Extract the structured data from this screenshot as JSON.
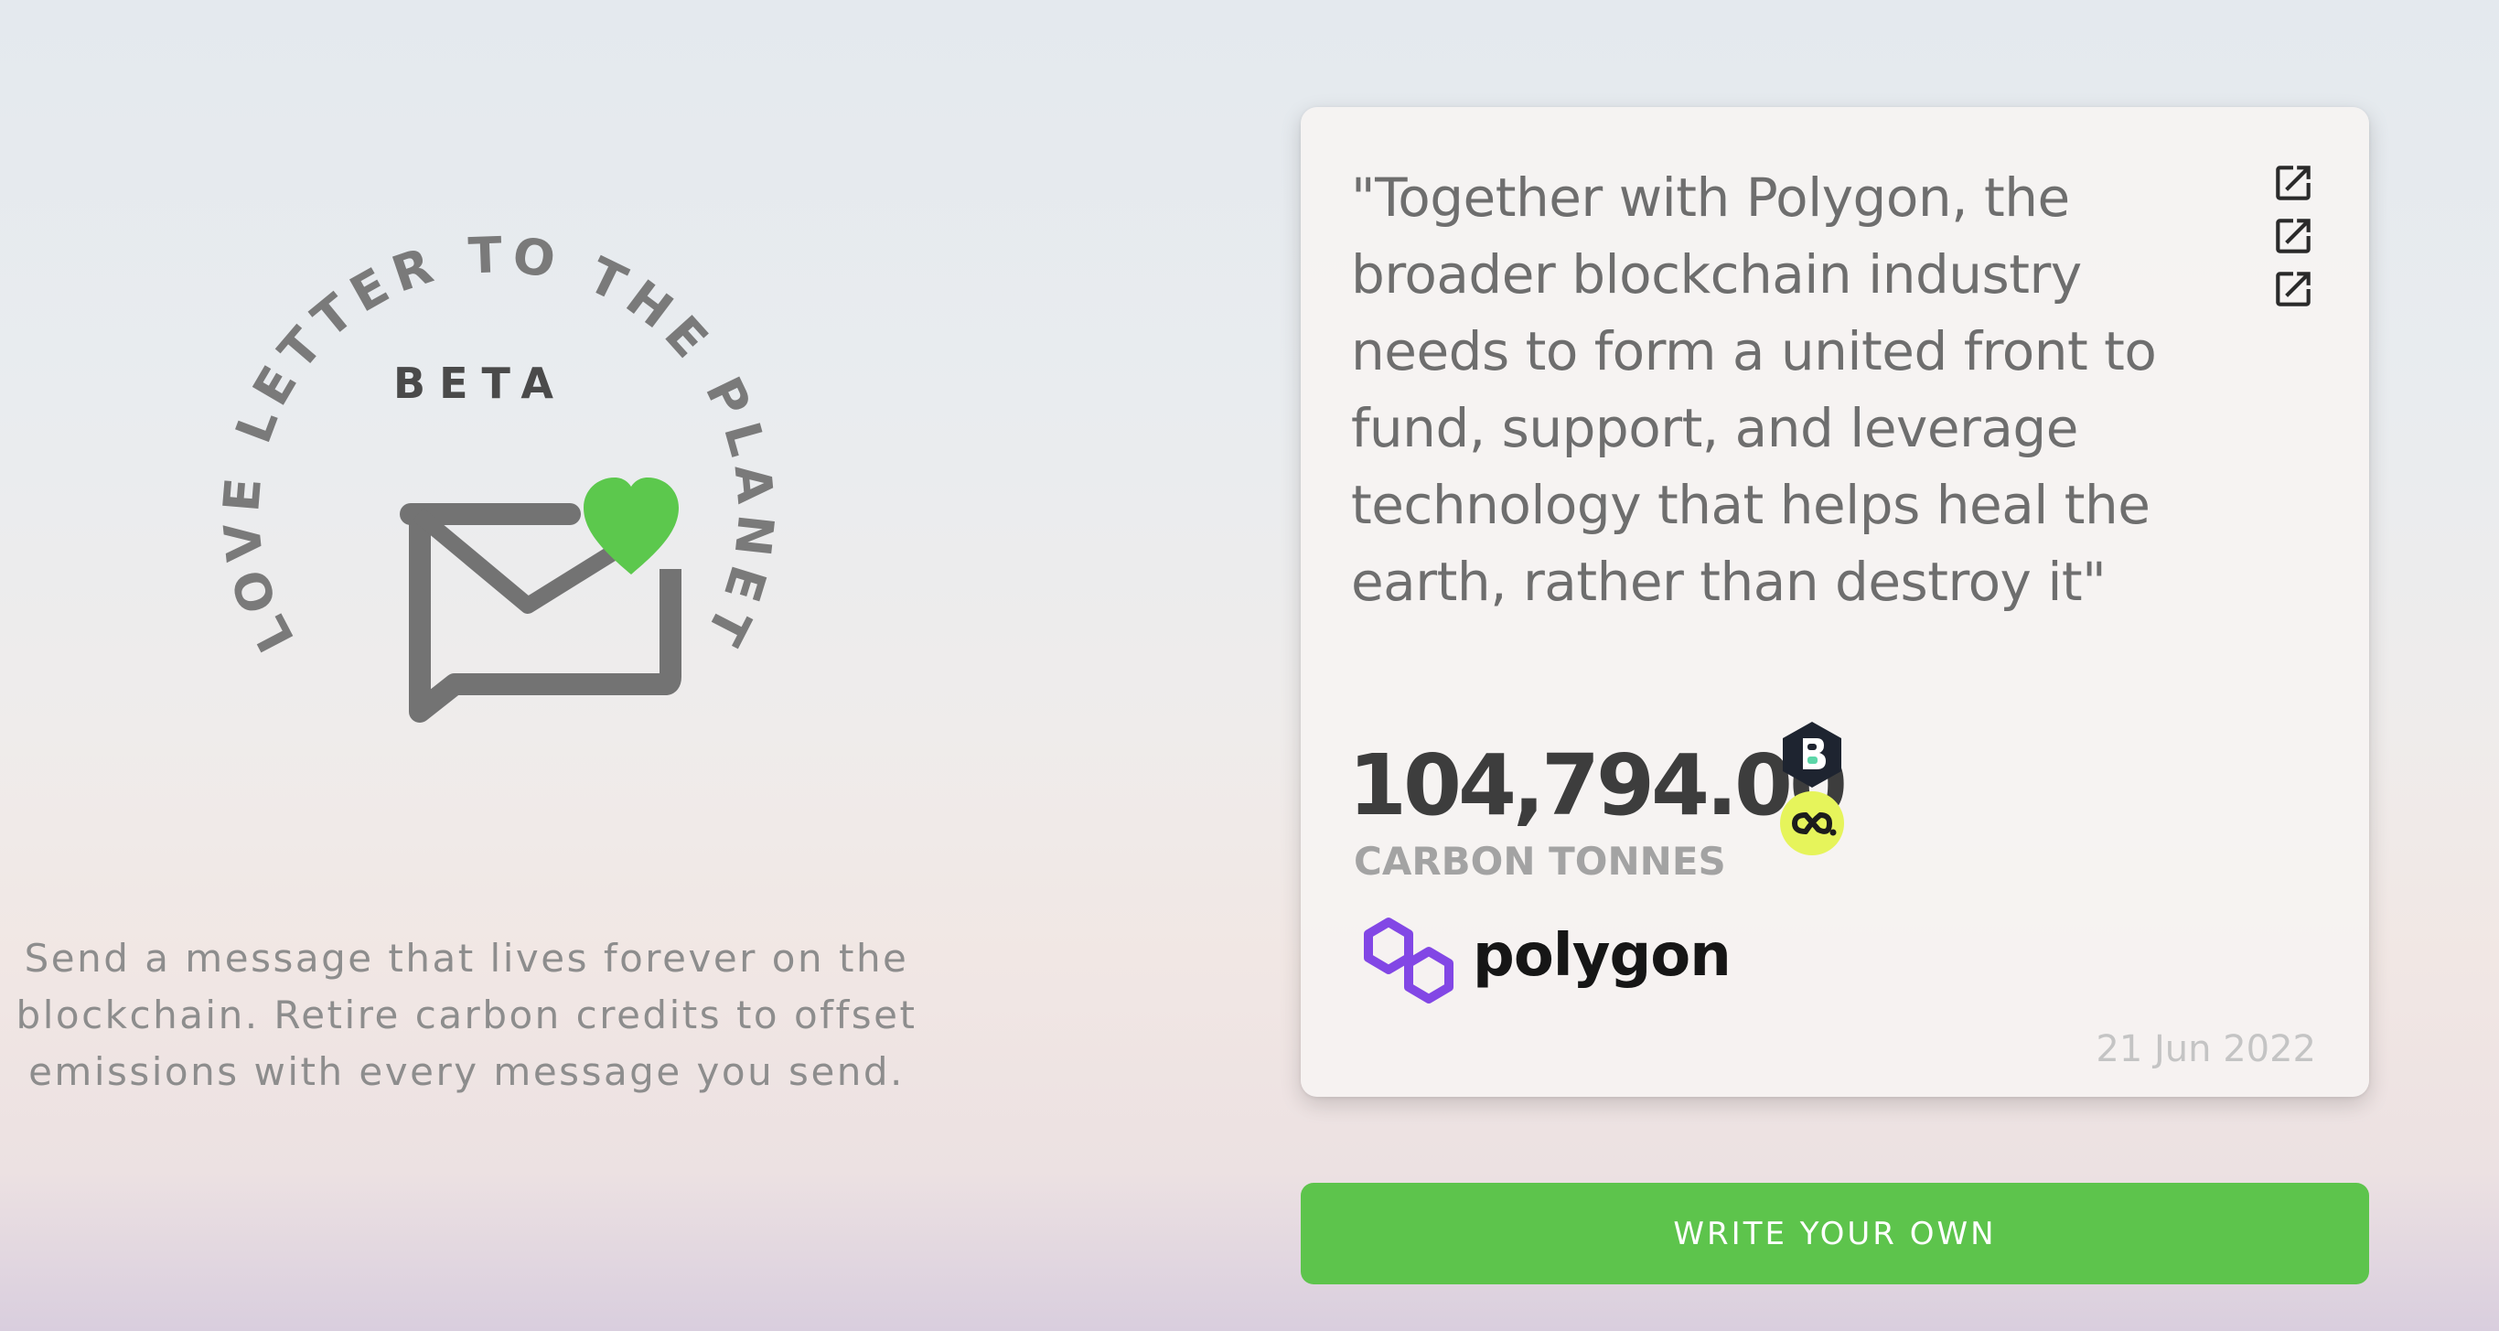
{
  "logo": {
    "arc_text": "LOVE LETTER TO THE PLANET",
    "badge": "BETA",
    "heart_color": "#5cc84d",
    "envelope_color": "#737373"
  },
  "tagline": "Send a message that lives forever on the blockchain. Retire carbon credits to offset emissions with every message you send.",
  "card": {
    "quote": "\"Together with Polygon, the broader blockchain industry needs to form a united front to fund, support, and leverage technology that helps heal the earth, rather than destroy it\"",
    "external_links": [
      "external-link-icon",
      "external-link-icon",
      "external-link-icon"
    ],
    "amount": "104,794.00",
    "unit": "CARBON TONNES",
    "tokens": [
      "bct-token-icon",
      "c3-token-icon"
    ],
    "sender_logo_text": "polygon",
    "sender_brand_color": "#8247e5",
    "date": "21 Jun 2022"
  },
  "cta": {
    "label": "WRITE YOUR OWN",
    "color": "#5dc44c"
  }
}
